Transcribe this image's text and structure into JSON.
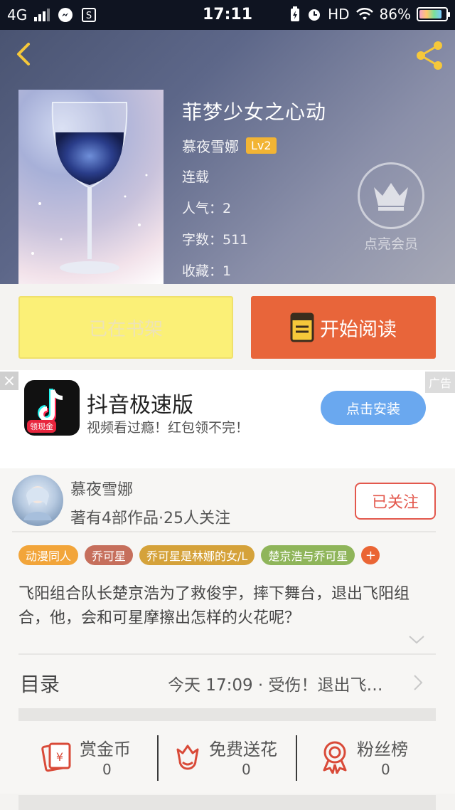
{
  "status_bar": {
    "network": "4G",
    "time": "17:11",
    "hd": "HD",
    "battery": "86%"
  },
  "book": {
    "title": "菲梦少女之心动",
    "author": "慕夜雪娜",
    "level": "Lv2",
    "status": "连载",
    "popularity": "人气：2",
    "word_count": "字数：511",
    "favorites": "收藏：1",
    "vip_label": "点亮会员"
  },
  "actions": {
    "shelf_label": "已在书架",
    "read_label": "开始阅读"
  },
  "ad": {
    "close": "×",
    "tag": "广告",
    "app_name": "抖音极速版",
    "app_badge": "领现金",
    "subtitle": "视频看过瘾！红包领不完！",
    "install": "点击安装"
  },
  "author_card": {
    "name": "慕夜雪娜",
    "stats": "著有4部作品·25人关注",
    "follow": "已关注"
  },
  "tags": [
    {
      "label": "动漫同人",
      "color": "#f2a53a"
    },
    {
      "label": "乔可星",
      "color": "#c66f5c"
    },
    {
      "label": "乔可星是林娜的女/L",
      "color": "#d5a23a"
    },
    {
      "label": "楚京浩与乔可星",
      "color": "#8fb55a"
    }
  ],
  "tag_more": "+",
  "description": "飞阳组合队长楚京浩为了救俊宇，摔下舞台，退出飞阳组合，他，会和可星摩擦出怎样的火花呢？",
  "toc": {
    "label": "目录",
    "latest": "今天 17:09 · 受伤！退出飞…"
  },
  "rewards": [
    {
      "label": "赏金币",
      "value": "0",
      "icon": "red-envelope-icon"
    },
    {
      "label": "免费送花",
      "value": "0",
      "icon": "flower-icon"
    },
    {
      "label": "粉丝榜",
      "value": "0",
      "icon": "medal-icon"
    }
  ]
}
